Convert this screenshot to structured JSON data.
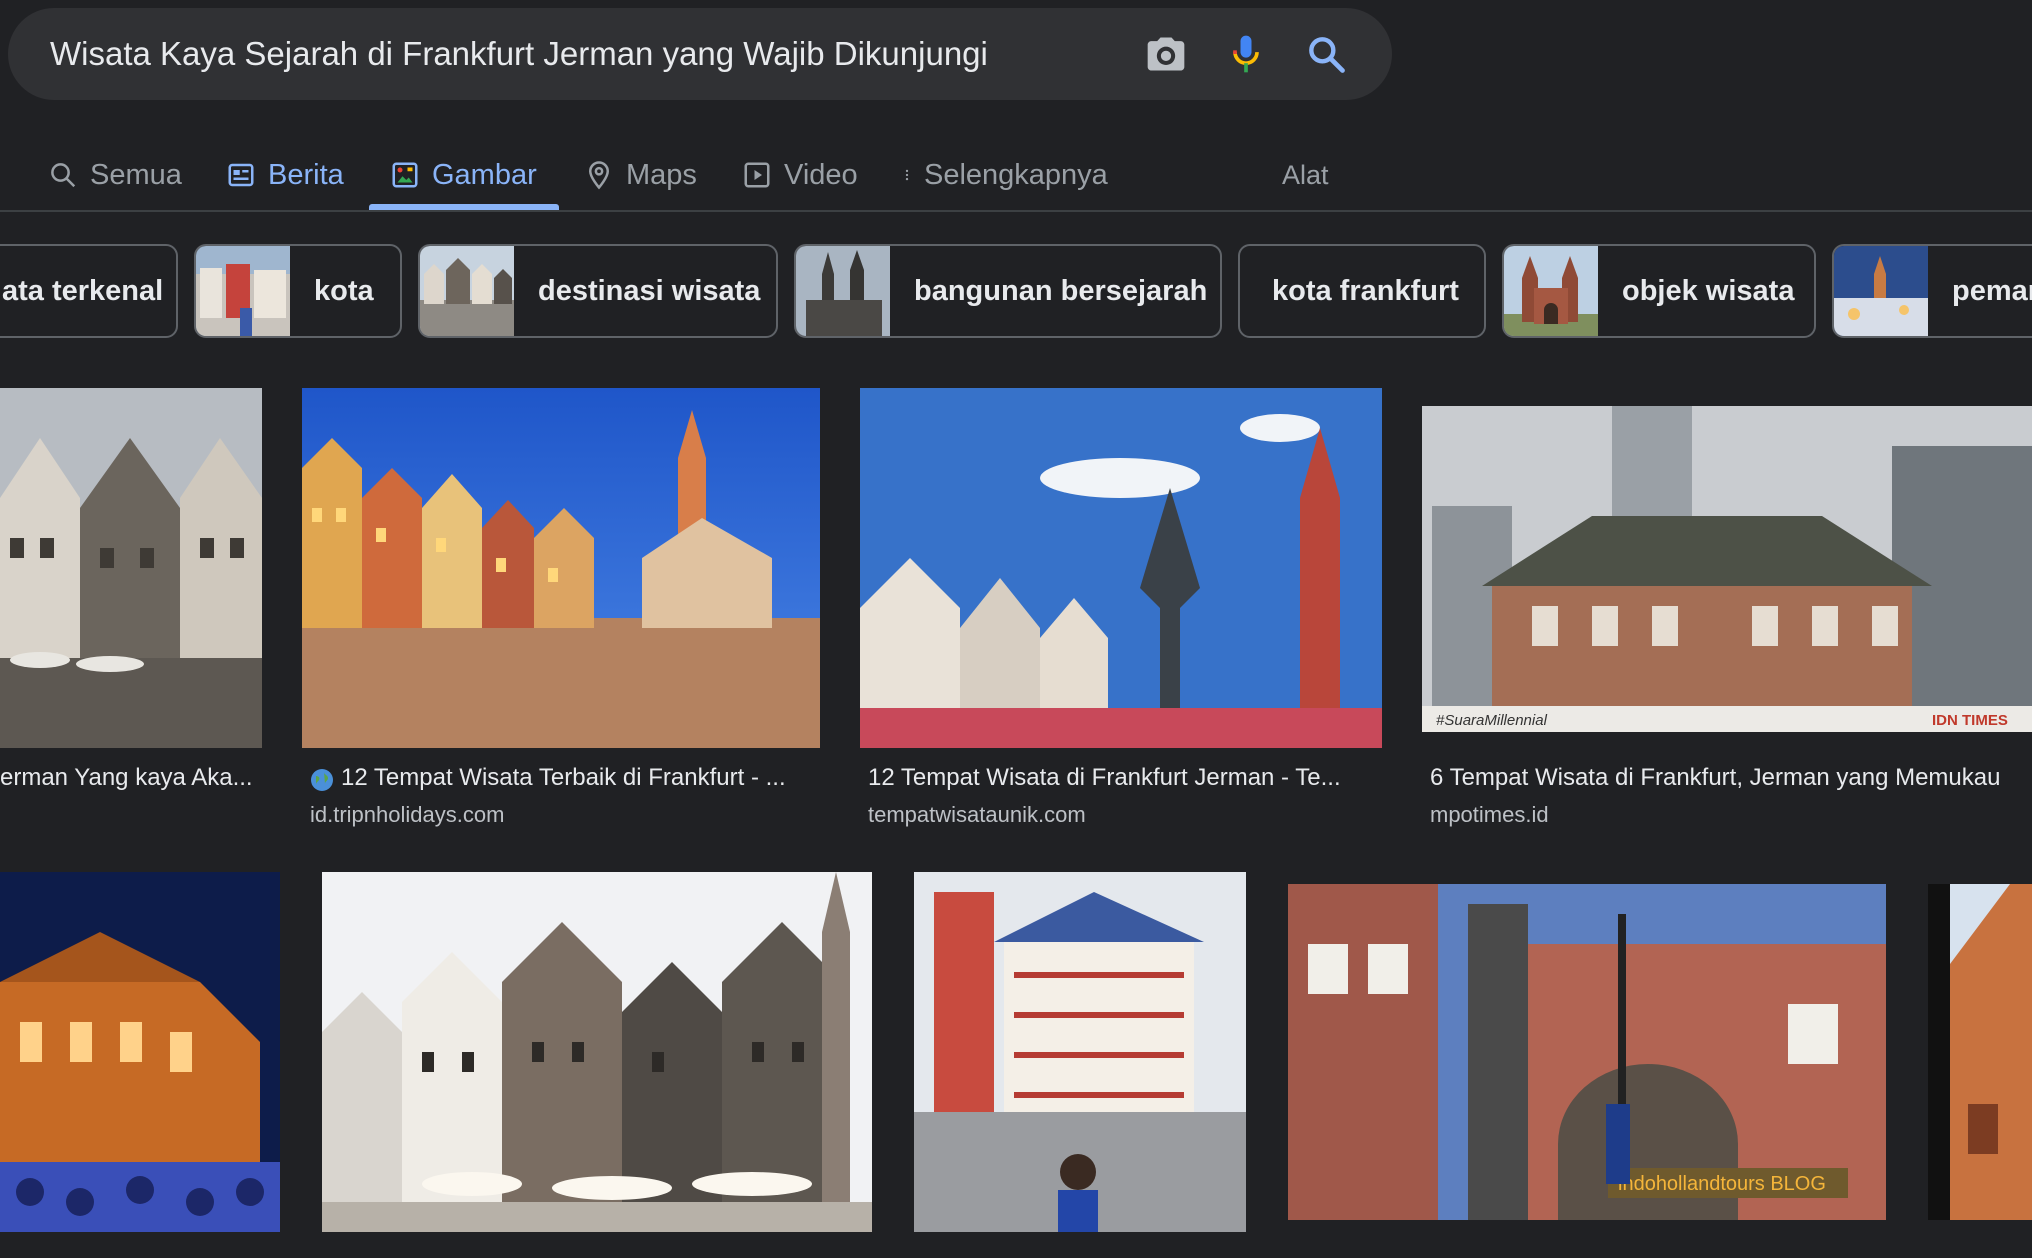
{
  "search": {
    "query": "Wisata Kaya Sejarah di Frankfurt Jerman yang Wajib Dikunjungi"
  },
  "tabs": [
    {
      "label": "Semua",
      "icon": "search-icon"
    },
    {
      "label": "Berita",
      "icon": "news-icon"
    },
    {
      "label": "Gambar",
      "icon": "image-icon",
      "active": true
    },
    {
      "label": "Maps",
      "icon": "map-pin-icon"
    },
    {
      "label": "Video",
      "icon": "play-icon"
    },
    {
      "label": "Selengkapnya",
      "icon": "more-vert-icon"
    }
  ],
  "tools_label": "Alat",
  "chips": [
    {
      "label": "ata terkenal"
    },
    {
      "label": "kota"
    },
    {
      "label": "destinasi wisata"
    },
    {
      "label": "bangunan bersejarah"
    },
    {
      "label": "kota frankfurt"
    },
    {
      "label": "objek wisata"
    },
    {
      "label": "pemar"
    }
  ],
  "results_row1": [
    {
      "title": "erman Yang kaya Aka...",
      "source": ""
    },
    {
      "title": "12 Tempat Wisata Terbaik di Frankfurt - ...",
      "source": "id.tripnholidays.com"
    },
    {
      "title": "12 Tempat Wisata di Frankfurt Jerman - Te...",
      "source": "tempatwisataunik.com"
    },
    {
      "title": "6 Tempat Wisata di Frankfurt, Jerman yang Memukau",
      "source": "mpotimes.id"
    }
  ],
  "results_row2": [
    {
      "watermark": ""
    },
    {
      "watermark": ""
    },
    {
      "watermark": ""
    },
    {
      "watermark": "indohollandtours BLOG"
    },
    {
      "watermark": ""
    }
  ],
  "watermarks": {
    "suara": "#SuaraMillennial",
    "idn": "IDN TIMES"
  },
  "colors": {
    "background": "#202124",
    "accent": "#8ab4f8",
    "searchbar": "#303134"
  }
}
